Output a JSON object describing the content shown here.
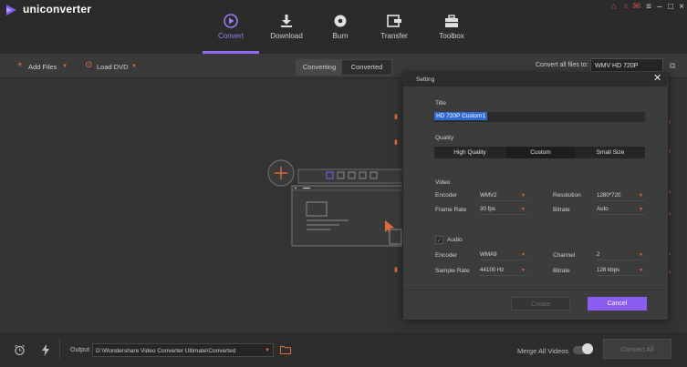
{
  "app": {
    "title": "uniconverter"
  },
  "nav": {
    "tabs": [
      {
        "label": "Convert"
      },
      {
        "label": "Download"
      },
      {
        "label": "Burn"
      },
      {
        "label": "Transfer"
      },
      {
        "label": "Toolbox"
      }
    ]
  },
  "toolbar": {
    "add_files": "Add Files",
    "load_dvd": "Load DVD",
    "seg_converting": "Converting",
    "seg_converted": "Converted",
    "convert_all_label": "Convert all files to:",
    "convert_all_value": "WMV HD 720P"
  },
  "dialog": {
    "title": "Setting",
    "title_label": "Title",
    "title_value": "HD 720P Custom1",
    "quality_label": "Quality",
    "quality_options": [
      "High Quality",
      "Custom",
      "Small Size"
    ],
    "quality_selected": "Custom",
    "video_label": "Video",
    "video": {
      "encoder_label": "Encoder",
      "encoder_value": "WMV2",
      "resolution_label": "Resolution",
      "resolution_value": "1280*720",
      "frame_rate_label": "Frame Rate",
      "frame_rate_value": "30 fps",
      "bitrate_label": "Bitrate",
      "bitrate_value": "Auto"
    },
    "audio_label": "Audio",
    "audio_checked": true,
    "audio": {
      "encoder_label": "Encoder",
      "encoder_value": "WMA9",
      "channel_label": "Channel",
      "channel_value": "2",
      "sample_rate_label": "Sample Rate",
      "sample_rate_value": "44100 Hz",
      "bitrate_label": "Bitrate",
      "bitrate_value": "128 kbps"
    },
    "create_label": "Create",
    "cancel_label": "Cancel"
  },
  "bottom": {
    "output_label": "Output",
    "output_path": "D:\\Wondershare Video Converter Ultimate\\Converted",
    "merge_label": "Merge All Videos",
    "merge_on": false,
    "convert_all_button": "Convert All"
  },
  "colors": {
    "accent": "#8b5cf0",
    "orange": "#e06a3a",
    "bg": "#333333"
  }
}
